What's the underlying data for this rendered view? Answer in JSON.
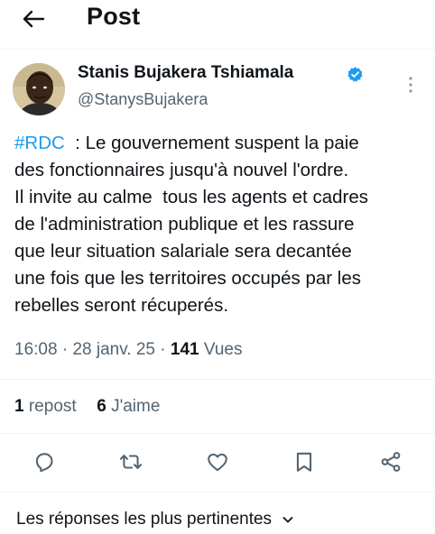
{
  "header": {
    "back_icon": "arrow-left-icon",
    "title": "Post"
  },
  "author": {
    "display_name": "Stanis Bujakera Tshiamala",
    "handle": "@StanysBujakera",
    "verified": true,
    "verified_icon": "verified-badge-icon",
    "more_icon": "more-vertical-icon"
  },
  "tweet": {
    "hashtag": "#RDC",
    "line1_rest": "  : Le gouvernement suspent la paie",
    "line2": "des fonctionnaires jusqu'à nouvel l'ordre.",
    "line3": "Il invite au calme  tous les agents et cadres",
    "line4": "de l'administration publique et les rassure",
    "line5": "que leur situation salariale sera decantée",
    "line6": "une fois que les territoires occupés par les",
    "line7": "rebelles seront récuperés."
  },
  "meta": {
    "time": "16:08",
    "separator": " · ",
    "date": "28 janv. 25",
    "views_count": "141",
    "views_label": " Vues"
  },
  "stats": {
    "reposts_count": "1",
    "reposts_label": " repost",
    "likes_count": "6",
    "likes_label": " J'aime"
  },
  "actions": {
    "reply_icon": "reply-icon",
    "repost_icon": "repost-icon",
    "like_icon": "heart-icon",
    "bookmark_icon": "bookmark-icon",
    "share_icon": "share-icon"
  },
  "replies": {
    "sort_label": "Les réponses les plus pertinentes",
    "sort_icon": "chevron-down-icon"
  },
  "colors": {
    "text": "#0f1419",
    "secondary": "#536471",
    "accent": "#1d9bf0",
    "divider": "#eff3f4"
  }
}
